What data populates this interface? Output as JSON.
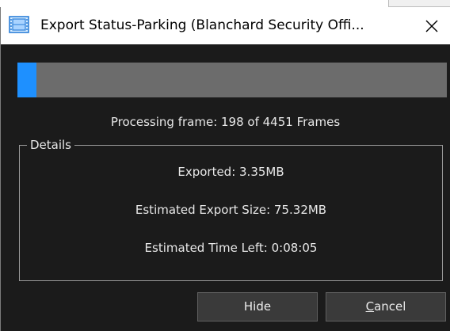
{
  "window": {
    "title": "Export Status-Parking (Blanchard Security Offi...",
    "icon": "film-strip-icon",
    "close_glyph": "✕"
  },
  "progress": {
    "current_frame": 198,
    "total_frames": 4451,
    "fraction": 0.0445,
    "text": "Processing frame: 198 of 4451 Frames",
    "fill_color": "#1e90ff"
  },
  "details": {
    "legend": "Details",
    "exported": "Exported: 3.35MB",
    "estimated_size": "Estimated Export Size: 75.32MB",
    "time_left": "Estimated Time Left: 0:08:05"
  },
  "buttons": {
    "hide": "Hide",
    "cancel": "Cancel"
  }
}
